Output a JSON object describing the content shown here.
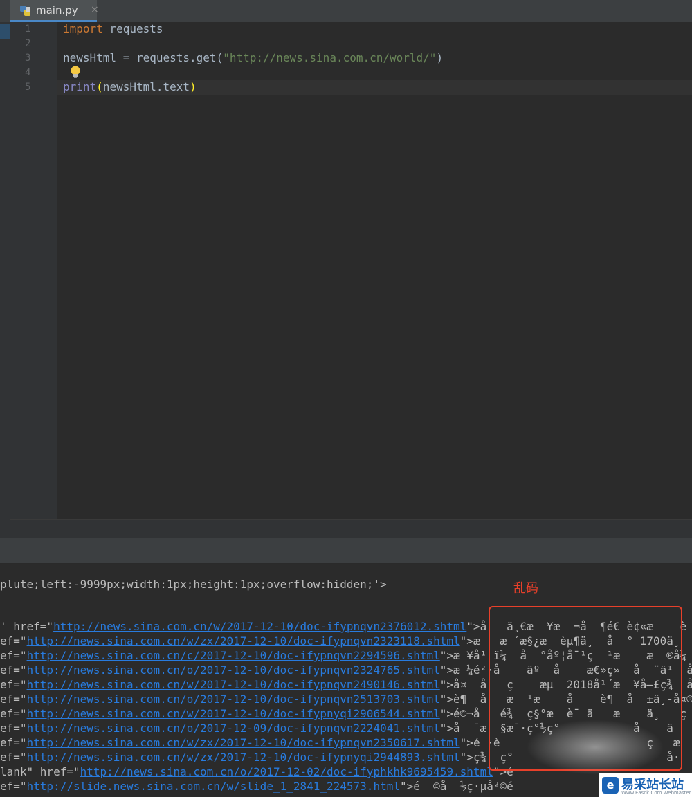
{
  "tab": {
    "file_name": "main.py",
    "close_glyph": "×"
  },
  "gutter": {
    "line_numbers": [
      "1",
      "2",
      "3",
      "4",
      "5"
    ]
  },
  "code": {
    "line1": {
      "kw": "import",
      "rest": " requests"
    },
    "line3": {
      "pre": "newsHtml = requests.get(",
      "str": "\"http://news.sina.com.cn/world/\"",
      "post": ")"
    },
    "line5": {
      "fn": "print",
      "open": "(",
      "arg": "newsHtml.text",
      "close": ")"
    }
  },
  "console": {
    "top_line": "plute;left:-9999px;width:1px;height:1px;overflow:hidden;'>",
    "rows": [
      {
        "prefix": "' href=\"",
        "url": "http://news.sina.com.cn/w/2017-12-10/doc-ifypnqvn2376012.shtml",
        "suffix": "\">å",
        "garble": "   ä¸€æ  ¥æ  ¬å  ¶é€ è¢«æ    è"
      },
      {
        "prefix": "ef=\"",
        "url": "http://news.sina.com.cn/w/zx/2017-12-10/doc-ifypnqvn2323118.shtml",
        "suffix": "\">æ",
        "garble": "   æ ´æ§¿æ  èµ¶ä¸  å  ° 1700ä¸"
      },
      {
        "prefix": "ef=\"",
        "url": "http://news.sina.com.cn/c/2017-12-10/doc-ifypnqvn2294596.shtml",
        "suffix": "\">æ ¥å¹",
        "garble": " ï¼  å  °åº¦å¯¹ç  ¹æ    æ  ®å¼"
      },
      {
        "prefix": "ef=\"",
        "url": "http://news.sina.com.cn/o/2017-12-10/doc-ifypnqvn2324765.shtml",
        "suffix": "\">æ ¼é²·å",
        "garble": "    äº  å    æ€»ç»  å  ¨ä¹  å"
      },
      {
        "prefix": "ef=\"",
        "url": "http://news.sina.com.cn/w/2017-12-10/doc-ifypnqvn2490146.shtml",
        "suffix": "\">å¤  å",
        "garble": "   ç    æµ  2018å¹´æ  ¥å–£ç¾  å"
      },
      {
        "prefix": "ef=\"",
        "url": "http://news.sina.com.cn/o/2017-12-10/doc-ifypnqvn2513703.shtml",
        "suffix": "\">è¶  å",
        "garble": "   æ  ¹æ    å    è¶  å  ±ä¸-å¤®æ"
      },
      {
        "prefix": "ef=\"",
        "url": "http://news.sina.com.cn/w/2017-12-10/doc-ifypnyqi2906544.shtml",
        "suffix": "\">é©¬å",
        "garble": "   é¾  ç§°æ  è¯ ä   æ    ä¸   ç"
      },
      {
        "prefix": "ef=\"",
        "url": "http://news.sina.com.cn/o/2017-12-09/doc-ifypnqvn2224041.shtml",
        "suffix": "\">å  ¯æ",
        "garble": "  §æ¯·ç°½ç°           å    ä"
      },
      {
        "prefix": "ef=\"",
        "url": "http://news.sina.com.cn/w/zx/2017-12-10/doc-ifypnqvn2350617.shtml",
        "suffix": "\">é",
        "garble": " ·è                      ç   æ"
      },
      {
        "prefix": "ef=\"",
        "url": "http://news.sina.com.cn/w/zx/2017-12-10/doc-ifypnyqi2944893.shtml",
        "suffix": "\">ç¾",
        "garble": "  ç°                       å·  è"
      },
      {
        "prefix": "lank\" href=\"",
        "url": "http://news.sina.com.cn/o/2017-12-02/doc-ifyphkhk9695459.shtml",
        "suffix": "\">é",
        "garble": ""
      },
      {
        "prefix": "ef=\"",
        "url": "http://slide.news.sina.com.cn/w/slide_1_2841_224573.html",
        "suffix": "\">é",
        "garble": "  ©å  ½ç·µå²©é"
      }
    ]
  },
  "annotation": {
    "label": "乱码",
    "color": "#e8402a"
  },
  "watermark": {
    "logo_glyph": "e",
    "title": "易采站长站",
    "subtitle": "Www.Easck.Com  Webmaster"
  }
}
